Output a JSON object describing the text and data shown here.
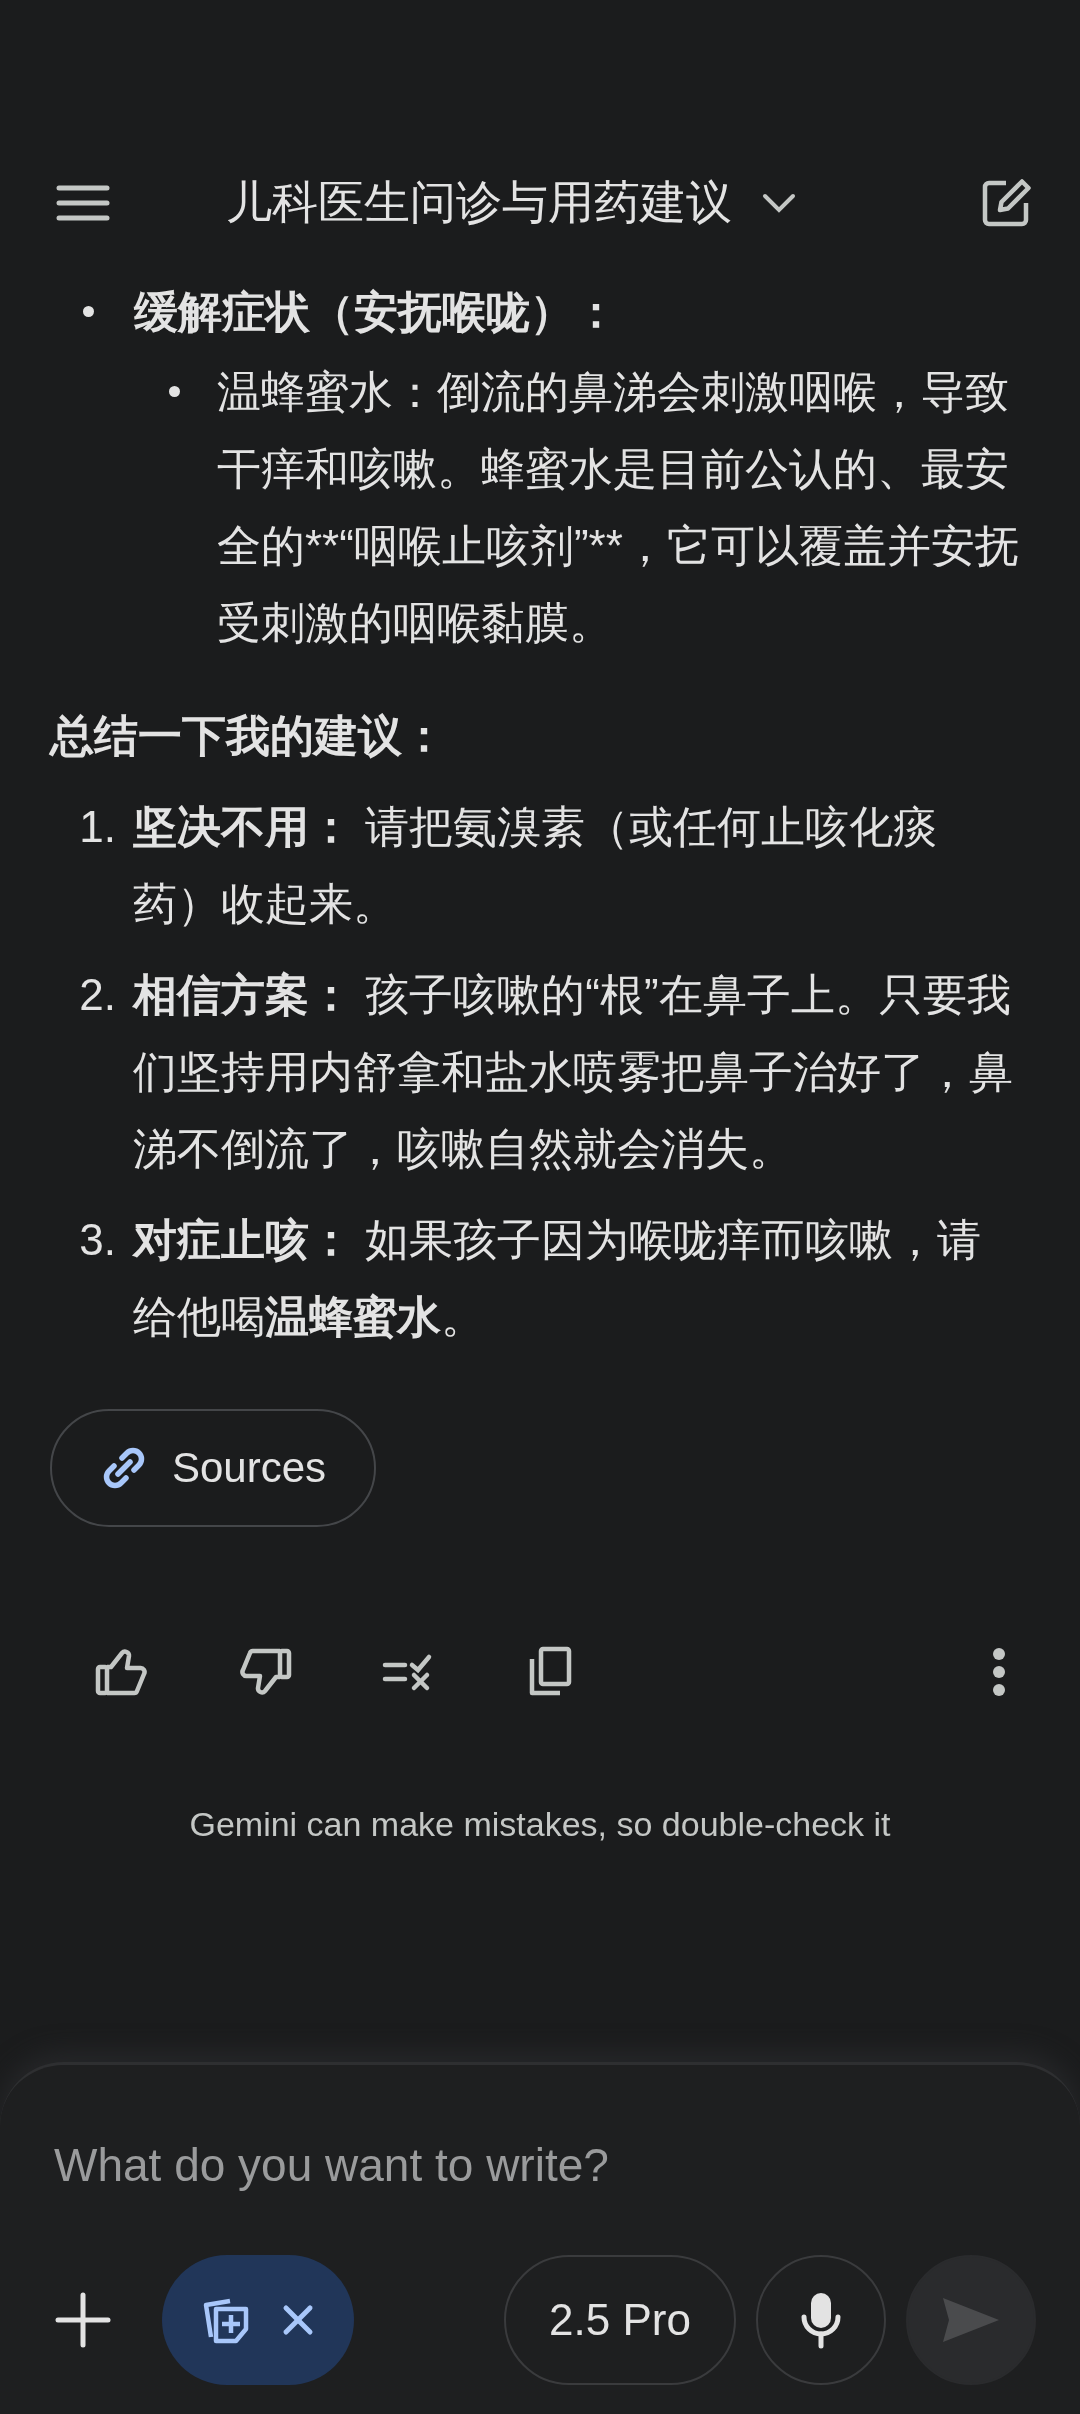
{
  "header": {
    "title": "儿科医生问诊与用药建议"
  },
  "bullets": [
    {
      "text": "缓解症状（安抚喉咙）：",
      "children": [
        {
          "text": "温蜂蜜水：倒流的鼻涕会刺激咽喉，导致干痒和咳嗽。蜂蜜水是目前公认的、最安全的**“咽喉止咳剂”**，它可以覆盖并安抚受刺激的咽喉黏膜。"
        }
      ]
    }
  ],
  "summary_heading": "总结一下我的建议：",
  "summary_items": [
    {
      "number": "1.",
      "text": "**坚决不用：** 请把氨溴素（或任何止咳化痰药）收起来。"
    },
    {
      "number": "2.",
      "text": "**相信方案：** 孩子咳嗽的“根”在鼻子上。只要我们坚持用内舒拿和盐水喷雾把鼻子治好了，鼻涕不倒流了，咳嗽自然就会消失。"
    },
    {
      "number": "3.",
      "text": "**对症止咳：** 如果孩子因为喉咙痒而咳嗽，请给他喝**温蜂蜜水**。"
    }
  ],
  "sources_button": "Sources",
  "disclaimer": "Gemini can make mistakes, so double-check it",
  "composer": {
    "placeholder": "What do you want to write?",
    "model": "2.5 Pro"
  }
}
